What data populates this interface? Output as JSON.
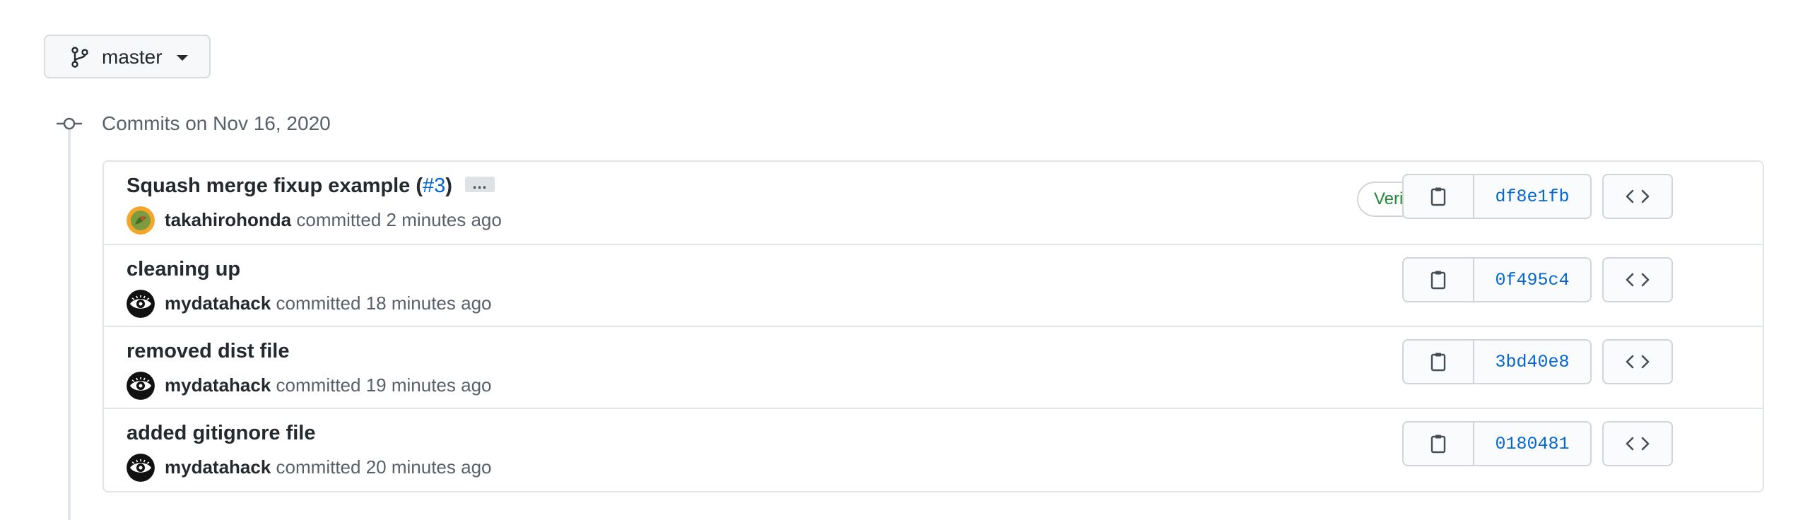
{
  "branch": {
    "name": "master",
    "icon": "git-branch-icon"
  },
  "timeline": {
    "group_title": "Commits on Nov 16, 2020",
    "icon": "git-commit-icon"
  },
  "commits": [
    {
      "title": "Squash merge fixup example (",
      "pr_link": "#3",
      "title_suffix": ")",
      "ellipsis": "…",
      "author": "takahirohonda",
      "action": "committed",
      "time": "2 minutes ago",
      "verified": "Verified",
      "sha": "df8e1fb",
      "avatar": "green-avatar"
    },
    {
      "title": "cleaning up",
      "author": "mydatahack",
      "action": "committed",
      "time": "18 minutes ago",
      "sha": "0f495c4",
      "avatar": "eye-avatar"
    },
    {
      "title": "removed dist file",
      "author": "mydatahack",
      "action": "committed",
      "time": "19 minutes ago",
      "sha": "3bd40e8",
      "avatar": "eye-avatar"
    },
    {
      "title": "added gitignore file",
      "author": "mydatahack",
      "action": "committed",
      "time": "20 minutes ago",
      "sha": "0180481",
      "avatar": "eye-avatar"
    }
  ],
  "colors": {
    "link": "#0366d6",
    "verified": "#22863a",
    "border": "#e1e4e8"
  }
}
